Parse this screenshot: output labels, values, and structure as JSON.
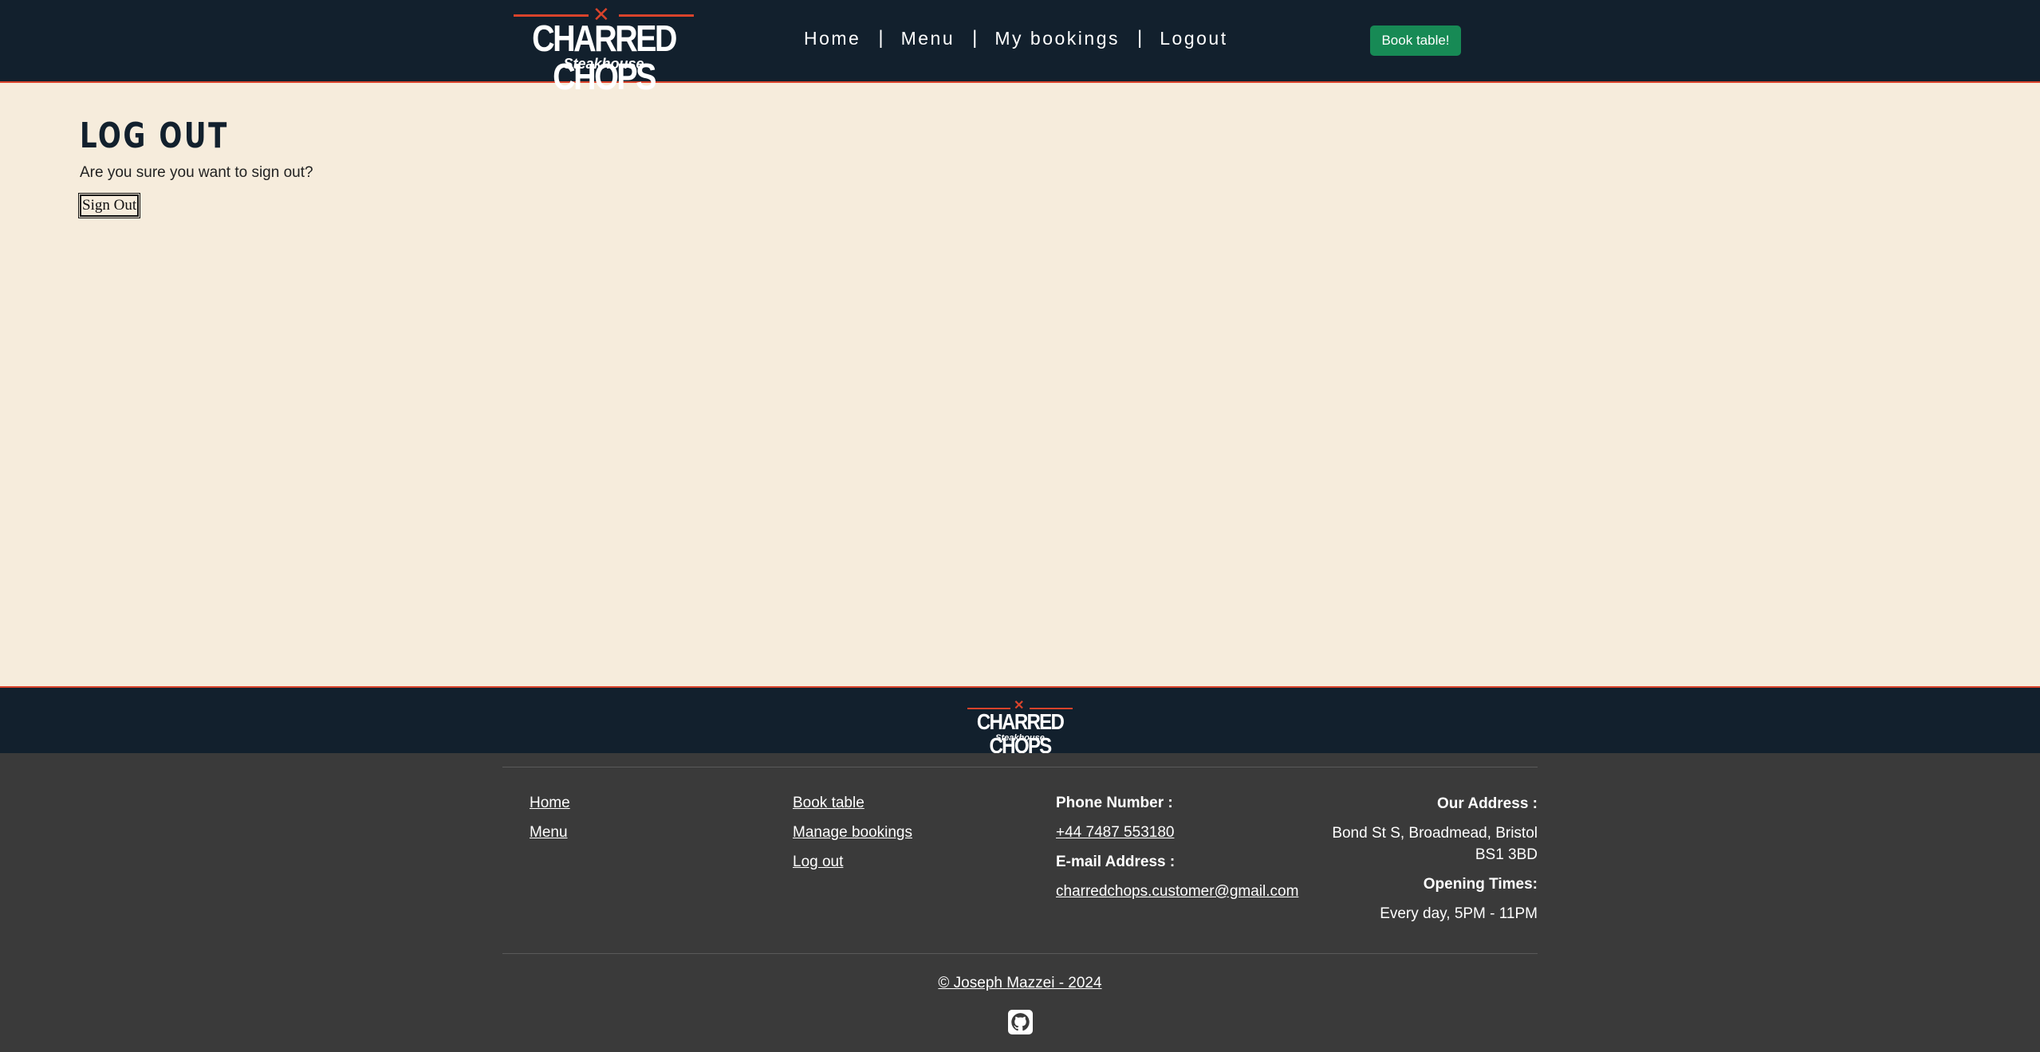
{
  "header": {
    "logo": {
      "main": "CHARRED CHOPS",
      "sub": "Steakhouse"
    },
    "nav": [
      "Home",
      "Menu",
      "My bookings",
      "Logout"
    ],
    "separator": "|",
    "book_button": "Book table!"
  },
  "main": {
    "title": "LOG OUT",
    "prompt": "Are you sure you want to sign out?",
    "signout_button": "Sign Out"
  },
  "footer": {
    "logo": {
      "main": "CHARRED CHOPS",
      "sub": "Steakhouse"
    },
    "col1": [
      "Home",
      "Menu"
    ],
    "col2": [
      "Book table",
      "Manage bookings",
      "Log out"
    ],
    "phone_label": "Phone Number :",
    "phone": "+44 7487 553180",
    "email_label": "E-mail Address :",
    "email": "charredchops.customer@gmail.com",
    "address_label": "Our Address :",
    "address": "Bond St S, Broadmead, Bristol BS1 3BD",
    "hours_label": "Opening Times:",
    "hours": "Every day, 5PM - 11PM",
    "copyright": "© Joseph Mazzei - 2024",
    "github_icon": "github-icon"
  },
  "colors": {
    "header_bg": "#12202d",
    "accent": "#d9432b",
    "page_bg": "#f6ecdc",
    "footer_bg": "#3a3a3a",
    "book_button": "#178a55"
  }
}
